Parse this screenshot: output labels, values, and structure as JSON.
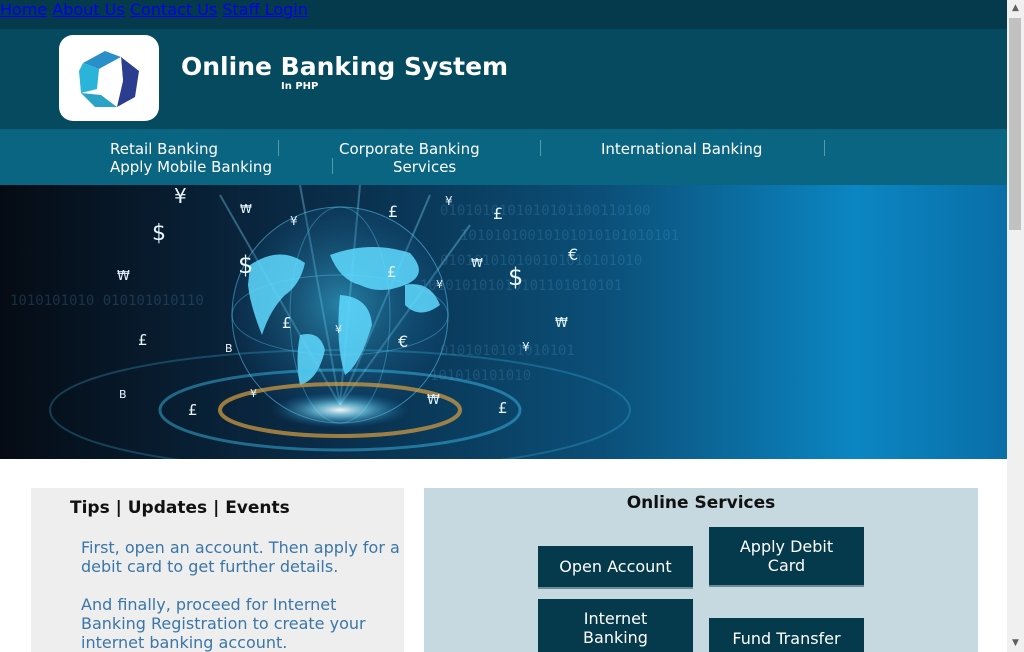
{
  "topnav": {
    "items": [
      "Home",
      "About Us",
      "Contact Us",
      "Staff Login"
    ]
  },
  "header": {
    "title": "Online Banking System",
    "subtitle": "In PHP",
    "logo_icon": "bank-logo-icon"
  },
  "subnav": {
    "retail": "Retail Banking",
    "corporate": "Corporate Banking",
    "international": "International Banking",
    "mobile": "Apply Mobile Banking",
    "services": "Services"
  },
  "tips": {
    "heading": "Tips | Updates | Events",
    "paragraphs": [
      "First, open an account. Then apply for a debit card to get further details.",
      "And finally, proceed for Internet Banking Registration to create your internet banking account."
    ]
  },
  "services": {
    "heading": "Online Services",
    "buttons": [
      "Open Account",
      "Apply Debit Card",
      "Internet Banking",
      "Fund Transfer"
    ]
  },
  "hero": {
    "currency_symbols": [
      "¥",
      "₩",
      "$",
      "£",
      "€",
      "B"
    ]
  },
  "colors": {
    "topbar": "#043a4c",
    "header": "#064a60",
    "subnav": "#0a6582",
    "button": "#043a4c",
    "tips_text": "#3a76a8"
  }
}
